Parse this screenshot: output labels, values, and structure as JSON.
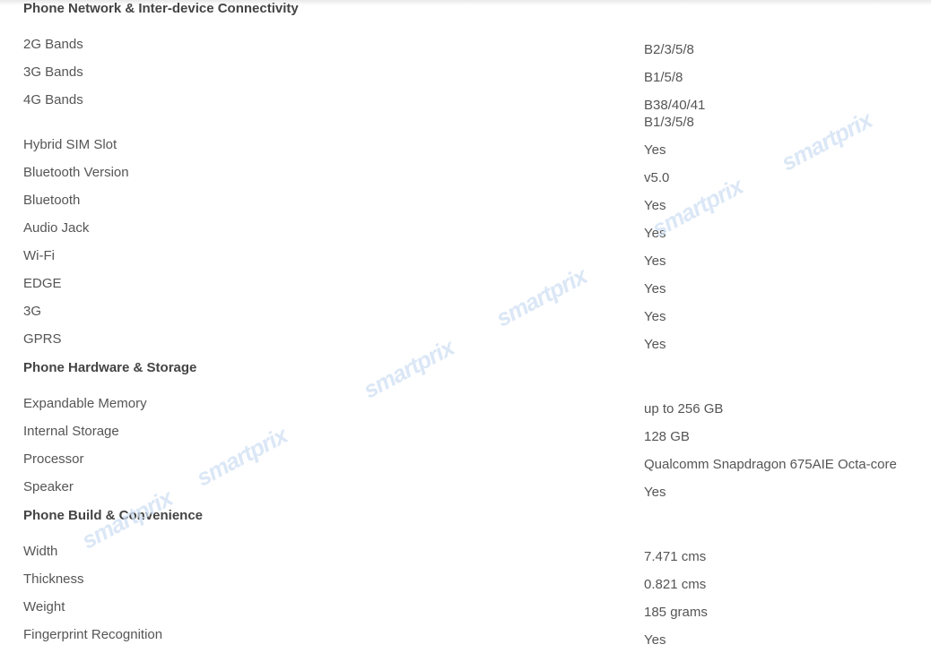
{
  "sections": [
    {
      "title": "Phone Network & Inter-device Connectivity",
      "rows": [
        {
          "label": "2G Bands",
          "values": [
            "B2/3/5/8"
          ]
        },
        {
          "label": "3G Bands",
          "values": [
            "B1/5/8"
          ]
        },
        {
          "label": "4G Bands",
          "values": [
            "B38/40/41",
            "B1/3/5/8"
          ]
        },
        {
          "label": "Hybrid SIM Slot",
          "values": [
            "Yes"
          ]
        },
        {
          "label": "Bluetooth Version",
          "values": [
            "v5.0"
          ]
        },
        {
          "label": "Bluetooth",
          "values": [
            "Yes"
          ]
        },
        {
          "label": "Audio Jack",
          "values": [
            "Yes"
          ]
        },
        {
          "label": "Wi-Fi",
          "values": [
            "Yes"
          ]
        },
        {
          "label": "EDGE",
          "values": [
            "Yes"
          ]
        },
        {
          "label": "3G",
          "values": [
            "Yes"
          ]
        },
        {
          "label": "GPRS",
          "values": [
            "Yes"
          ]
        }
      ]
    },
    {
      "title": "Phone Hardware & Storage",
      "rows": [
        {
          "label": "Expandable Memory",
          "values": [
            "up to 256 GB"
          ]
        },
        {
          "label": "Internal Storage",
          "values": [
            "128 GB"
          ]
        },
        {
          "label": "Processor",
          "values": [
            "Qualcomm Snapdragon 675AIE Octa-core"
          ]
        },
        {
          "label": "Speaker",
          "values": [
            "Yes"
          ]
        }
      ]
    },
    {
      "title": "Phone Build & Convenience",
      "rows": [
        {
          "label": "Width",
          "values": [
            "7.471 cms"
          ]
        },
        {
          "label": "Thickness",
          "values": [
            "0.821 cms"
          ]
        },
        {
          "label": "Weight",
          "values": [
            "185 grams"
          ]
        },
        {
          "label": "Fingerprint Recognition",
          "values": [
            "Yes"
          ]
        }
      ]
    }
  ],
  "watermark_text": "smartprix",
  "colors": {
    "text": "#555555",
    "heading": "#444444",
    "watermark": "#cfe0f3"
  }
}
